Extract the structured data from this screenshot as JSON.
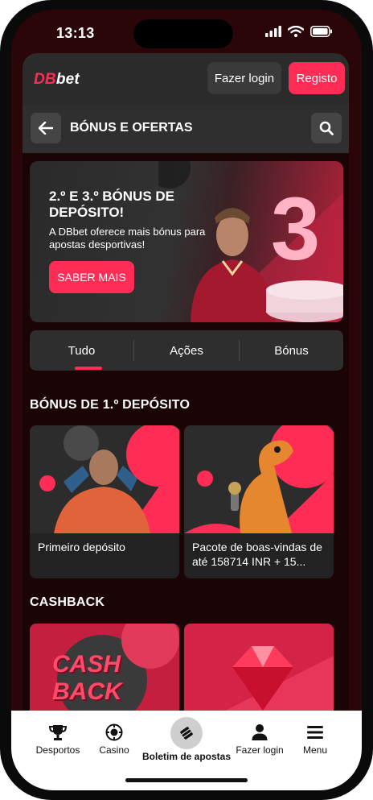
{
  "status": {
    "time": "13:13"
  },
  "header": {
    "logo_db": "DB",
    "logo_bet": "bet",
    "login": "Fazer login",
    "register": "Registo"
  },
  "subheader": {
    "title": "BÓNUS E OFERTAS"
  },
  "banner": {
    "title": "2.º E 3.º BÓNUS DE DEPÓSITO!",
    "text": "A DBbet oferece mais bónus para apostas desportivas!",
    "cta": "SABER MAIS",
    "numeral": "3"
  },
  "tabs": [
    {
      "label": "Tudo",
      "active": true
    },
    {
      "label": "Ações",
      "active": false
    },
    {
      "label": "Bónus",
      "active": false
    }
  ],
  "sections": [
    {
      "title": "BÓNUS DE 1.º DEPÓSITO",
      "cards": [
        {
          "label": "Primeiro depósito"
        },
        {
          "label": "Pacote de boas-vindas de até 158714 INR + 15..."
        }
      ]
    },
    {
      "title": "CASHBACK",
      "cards": [
        {
          "label": "",
          "art": "CASH BACK"
        },
        {
          "label": ""
        }
      ]
    }
  ],
  "tabbar": {
    "items": [
      {
        "label": "Desportos",
        "icon": "trophy-icon"
      },
      {
        "label": "Casino",
        "icon": "casino-chip-icon"
      },
      {
        "label": "Boletim de apostas",
        "icon": "betslip-ticket-icon"
      },
      {
        "label": "Fazer login",
        "icon": "user-icon"
      },
      {
        "label": "Menu",
        "icon": "hamburger-menu-icon"
      }
    ]
  },
  "colors": {
    "accent": "#ff2d55",
    "background": "#2a0608",
    "panel": "#2b2b2b"
  }
}
